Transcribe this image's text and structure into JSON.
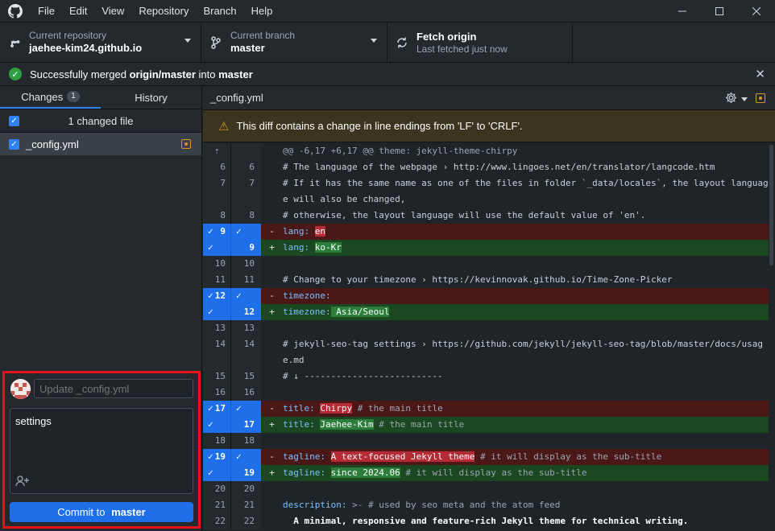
{
  "menu": [
    "File",
    "Edit",
    "View",
    "Repository",
    "Branch",
    "Help"
  ],
  "toolbar": {
    "repo_label": "Current repository",
    "repo_value": "jaehee-kim24.github.io",
    "branch_label": "Current branch",
    "branch_value": "master",
    "fetch_label": "Fetch origin",
    "fetch_sub": "Last fetched just now"
  },
  "banner": {
    "prefix": "Successfully merged ",
    "source": "origin/master",
    "middle": " into ",
    "target": "master"
  },
  "sidebar": {
    "tab_changes": "Changes",
    "changes_count": "1",
    "tab_history": "History",
    "changed_files_text": "1 changed file",
    "file_name": "_config.yml"
  },
  "commit": {
    "summary_placeholder": "Update _config.yml",
    "description": "settings",
    "button_prefix": "Commit to",
    "button_branch": "master"
  },
  "diff": {
    "file_title": "_config.yml",
    "warning": "This diff contains a change in line endings from 'LF' to 'CRLF'.",
    "hunk_header": "@@ -6,17 +6,17 @@ theme: jekyll-theme-chirpy",
    "lines": {
      "l6": "# The language of the webpage › http://www.lingoes.net/en/translator/langcode.htm",
      "l7": "# If it has the same name as one of the files in folder `_data/locales`, the layout language will also be changed,",
      "l8": "# otherwise, the layout language will use the default value of 'en'.",
      "l9_del_key": "lang:",
      "l9_del_val": "en",
      "l9_add_key": "lang:",
      "l9_add_val": "ko-Kr",
      "l11": "# Change to your timezone › https://kevinnovak.github.io/Time-Zone-Picker",
      "l12_del_key": "timezone:",
      "l12_add_key": "timezone:",
      "l12_add_val": " Asia/Seoul",
      "l14": "# jekyll-seo-tag settings › https://github.com/jekyll/jekyll-seo-tag/blob/master/docs/usage.md",
      "l15": "# ↓ --------------------------",
      "l17_del_key": "title:",
      "l17_del_val": "Chirpy",
      "l17_del_cmt": " # the main title",
      "l17_add_key": "title:",
      "l17_add_val": "Jaehee-Kim",
      "l17_add_cmt": " # the main title",
      "l19_del_key": "tagline:",
      "l19_del_val": "A text-focused Jekyll theme",
      "l19_del_cmt": " # it will display as the sub-title",
      "l19_add_key": "tagline:",
      "l19_add_val": "since 2024.06",
      "l19_add_cmt": " # it will display as the sub-title",
      "l21_key": "description:",
      "l21_rest": " >- # used by seo meta and the atom feed",
      "l22": "  A minimal, responsive and feature-rich Jekyll theme for technical writing."
    },
    "numbers": {
      "n6": "6",
      "n7": "7",
      "n8": "8",
      "n9": "9",
      "n10": "10",
      "n11": "11",
      "n12": "12",
      "n13": "13",
      "n14": "14",
      "n15": "15",
      "n16": "16",
      "n17": "17",
      "n18": "18",
      "n19": "19",
      "n20": "20",
      "n21": "21",
      "n22": "22"
    },
    "markers": {
      "del": "-",
      "add": "+",
      "expand": "⇡"
    }
  },
  "colors": {
    "accent": "#1f6feb",
    "success": "#2ea043",
    "warning": "#d29922",
    "highlight_border": "#e5121b",
    "deleted_bg": "#4b1818",
    "added_bg": "#1b4721"
  },
  "icons": {
    "app": "github-logo-icon",
    "repo": "repo-icon",
    "branch": "branch-icon",
    "fetch": "sync-icon",
    "banner": "check-circle-icon",
    "settings": "gear-icon",
    "warning": "warning-icon",
    "coauthor": "add-person-icon"
  }
}
